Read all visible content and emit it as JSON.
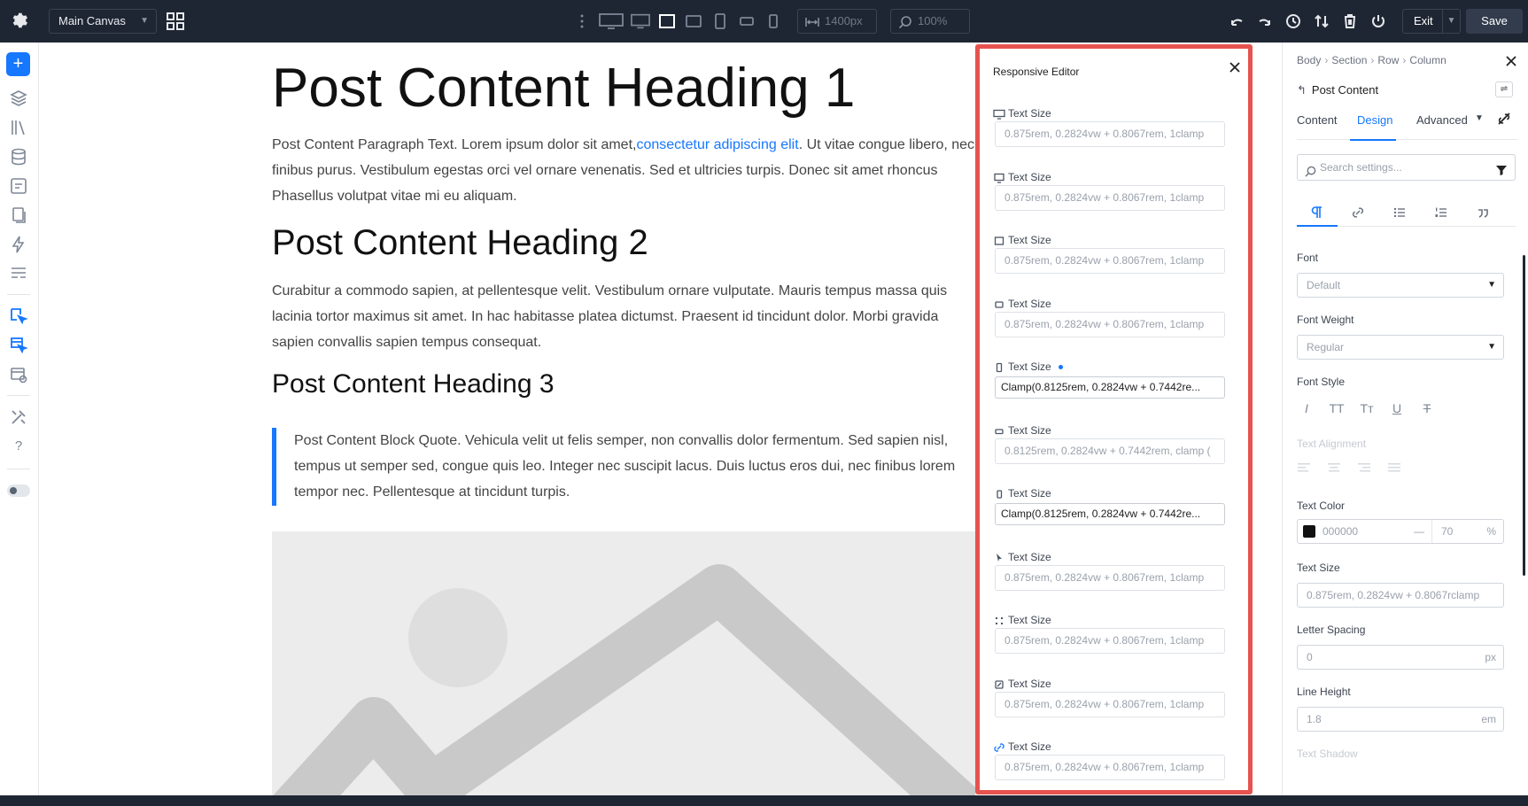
{
  "topbar": {
    "canvas_select": "Main Canvas",
    "width_value": "1400px",
    "zoom_value": "100%",
    "exit_label": "Exit",
    "save_label": "Save"
  },
  "canvas": {
    "heading1": "Post Content Heading 1",
    "para1": {
      "line1_before": "Post Content Paragraph Text. Lorem ipsum dolor sit amet,",
      "line1_link": "consectetur adipiscing elit",
      "line1_after": ". Ut vitae congue libero, nec",
      "line2": "finibus purus. Vestibulum egestas orci vel ornare venenatis. Sed et ultricies turpis. Donec sit amet rhoncus",
      "line3": "Phasellus volutpat vitae mi eu aliquam."
    },
    "heading2": "Post Content Heading 2",
    "para2": {
      "line1": "Curabitur a commodo sapien, at pellentesque velit. Vestibulum ornare vulputate. Mauris tempus massa quis",
      "line2": "lacinia tortor maximus sit amet. In hac habitasse platea dictumst. Praesent id tincidunt dolor. Morbi gravida",
      "line3": "sapien convallis sapien tempus consequat."
    },
    "heading3": "Post Content Heading 3",
    "quote": {
      "line1": "Post Content Block Quote. Vehicula velit ut felis semper, non convallis dolor fermentum. Sed sapien nisl,",
      "line2": "tempus ut semper sed, congue quis leo. Integer nec suscipit lacus. Duis luctus eros dui, nec finibus lorem",
      "line3": "tempor nec. Pellentesque at tincidunt turpis."
    }
  },
  "responsive_editor": {
    "title": "Responsive Editor",
    "items": [
      {
        "icon": "desktop-wide-icon",
        "label": "Text Size",
        "value": "0.875rem, 0.2824vw + 0.8067rem, 1clamp",
        "filled": false,
        "modified": false
      },
      {
        "icon": "desktop-icon",
        "label": "Text Size",
        "value": "0.875rem, 0.2824vw + 0.8067rem, 1clamp",
        "filled": false,
        "modified": false
      },
      {
        "icon": "tablet-landscape-icon",
        "label": "Text Size",
        "value": "0.875rem, 0.2824vw + 0.8067rem, 1clamp",
        "filled": false,
        "modified": false
      },
      {
        "icon": "tablet-icon",
        "label": "Text Size",
        "value": "0.875rem, 0.2824vw + 0.8067rem, 1clamp",
        "filled": false,
        "modified": false
      },
      {
        "icon": "phone-wide-icon",
        "label": "Text Size",
        "value": "Clamp(0.8125rem, 0.2824vw + 0.7442re...",
        "filled": true,
        "modified": true
      },
      {
        "icon": "phone-landscape-icon",
        "label": "Text Size",
        "value": "0.8125rem, 0.2824vw + 0.7442rem, clamp (",
        "filled": false,
        "modified": false
      },
      {
        "icon": "phone-icon",
        "label": "Text Size",
        "value": "Clamp(0.8125rem, 0.2824vw + 0.7442re...",
        "filled": true,
        "modified": false
      },
      {
        "icon": "cursor-hover-icon",
        "label": "Text Size",
        "value": "0.875rem, 0.2824vw + 0.8067rem, 1clamp",
        "filled": false,
        "modified": false
      },
      {
        "icon": "sticky-icon",
        "label": "Text Size",
        "value": "0.875rem, 0.2824vw + 0.8067rem, 1clamp",
        "filled": false,
        "modified": false
      },
      {
        "icon": "preset-icon",
        "label": "Text Size",
        "value": "0.875rem, 0.2824vw + 0.8067rem, 1clamp",
        "filled": false,
        "modified": false
      },
      {
        "icon": "link-state-icon",
        "label": "Text Size",
        "value": "0.875rem, 0.2824vw + 0.8067rem, 1clamp",
        "filled": false,
        "modified": false
      }
    ]
  },
  "settings": {
    "breadcrumb": [
      "Body",
      "Section",
      "Row",
      "Column"
    ],
    "module_name": "Post Content",
    "tabs": {
      "content": "Content",
      "design": "Design",
      "advanced": "Advanced"
    },
    "search_placeholder": "Search settings...",
    "font_label": "Font",
    "font_value": "Default",
    "font_weight_label": "Font Weight",
    "font_weight_value": "Regular",
    "font_style_label": "Font Style",
    "font_style_options": [
      "I",
      "TT",
      "Tт",
      "U",
      "T"
    ],
    "text_alignment_label": "Text Alignment",
    "text_color_label": "Text Color",
    "text_color_hex": "000000",
    "text_color_dash": "—",
    "text_color_opacity": "70",
    "text_color_opacity_unit": "%",
    "text_size_label": "Text Size",
    "text_size_value": "0.875rem, 0.2824vw + 0.8067rclamp",
    "letter_spacing_label": "Letter Spacing",
    "letter_spacing_value": "0",
    "letter_spacing_unit": "px",
    "line_height_label": "Line Height",
    "line_height_value": "1.8",
    "line_height_unit": "em",
    "text_shadow_label": "Text Shadow"
  },
  "colors": {
    "accent": "#1677ff",
    "topbar": "#1f2633",
    "highlight_border": "#e6534f"
  }
}
